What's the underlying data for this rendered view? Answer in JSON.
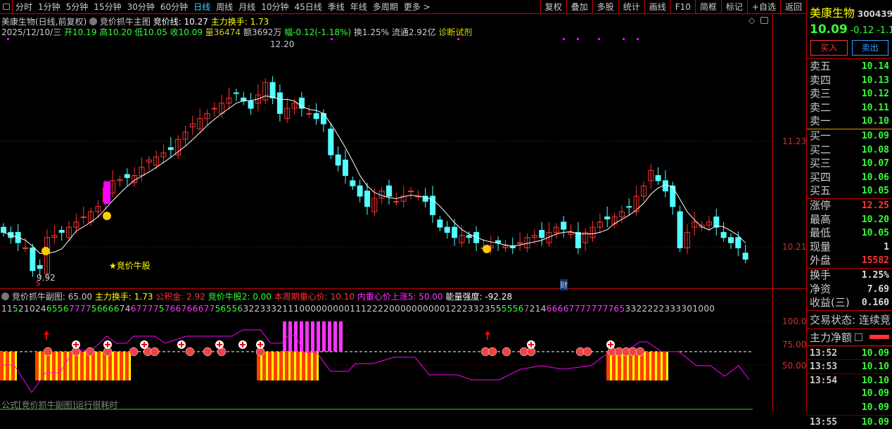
{
  "toolbar": {
    "periods": [
      "分时",
      "1分钟",
      "5分钟",
      "15分钟",
      "30分钟",
      "60分钟",
      "日线",
      "周线",
      "月线",
      "10分钟",
      "45日线",
      "季线",
      "年线",
      "多周期",
      "更多 >"
    ],
    "active": "日线",
    "actions": [
      "复权",
      "叠加",
      "多股",
      "统计",
      "画线",
      "F10",
      "简框",
      "标记",
      "+自选",
      "返回"
    ]
  },
  "header": {
    "stock": "美康生物(日线,前复权)",
    "indicator": "竞价抓牛主图",
    "jjx_label": "竞价线: 10.27",
    "zlhs_label": "主力换手: 1.73"
  },
  "quote_line": {
    "date": "2025/12/10/三",
    "open": "开10.19",
    "high": "高10.20",
    "low": "低10.05",
    "close": "收10.09",
    "volume": "量36474",
    "amount": "额3692万",
    "change": "幅-0.12(-1.18%)",
    "turnover": "换1.25%",
    "float": "流通2.92亿",
    "diag": "诊断试剂"
  },
  "chart_data": {
    "type": "candlestick",
    "yticks": [
      "11.23",
      "10.21"
    ],
    "max_label": "12.20",
    "min_label": "9.92",
    "annotations": [
      "★竞价牛股",
      "财",
      "S"
    ],
    "closes": [
      10.35,
      10.3,
      10.25,
      10.2,
      9.98,
      10.0,
      10.3,
      10.32,
      10.35,
      10.4,
      10.45,
      10.5,
      10.55,
      10.6,
      10.78,
      10.85,
      10.86,
      10.88,
      10.9,
      10.98,
      11.05,
      11.08,
      11.12,
      11.15,
      11.25,
      11.32,
      11.4,
      11.45,
      11.5,
      11.55,
      11.6,
      11.65,
      11.7,
      11.62,
      11.55,
      11.68,
      11.8,
      11.65,
      11.5,
      11.55,
      11.6,
      11.55,
      11.5,
      11.45,
      11.4,
      11.1,
      11.0,
      10.9,
      10.8,
      10.7,
      10.6,
      10.68,
      10.75,
      10.7,
      10.65,
      10.7,
      10.75,
      10.7,
      10.65,
      10.52,
      10.4,
      10.35,
      10.3,
      10.32,
      10.3,
      10.25,
      10.2,
      10.22,
      10.25,
      10.22,
      10.2,
      10.25,
      10.3,
      10.32,
      10.3,
      10.35,
      10.4,
      10.38,
      10.35,
      10.2,
      10.35,
      10.4,
      10.45,
      10.48,
      10.5,
      10.55,
      10.6,
      10.7,
      10.8,
      10.95,
      10.85,
      10.75,
      10.6,
      10.2,
      10.35,
      10.45,
      10.42,
      10.45,
      10.4,
      10.3,
      10.25,
      10.2,
      10.09
    ],
    "up_color": "#ff3232",
    "down_color": "#54ffff",
    "ma_color": "#ffffff"
  },
  "sub": {
    "name": "竞价抓牛副图",
    "v1": ": 65.00",
    "zlhs": "主力换手: 1.73",
    "gjj": "公积金: 2.92",
    "jjng": "竞价牛股2: 0.00",
    "zxj": "本周期重心价: 10.10",
    "sz": "内重心价上涨5: 50.00",
    "nl": "能量强度: -92.28",
    "yticks": [
      "100.0",
      "75.00",
      "50.00"
    ],
    "digits": [
      [
        "11",
        "#ccc"
      ],
      [
        "5",
        "#3f3"
      ],
      [
        "21024",
        "#ccc"
      ],
      [
        "6556",
        "#3f3"
      ],
      [
        "7777",
        "#f3f"
      ],
      [
        "56666",
        "#3f3"
      ],
      [
        "74",
        "#ccc"
      ],
      [
        "67777",
        "#f3f"
      ],
      [
        "5",
        "#3f3"
      ],
      [
        "766766677",
        "#f3f"
      ],
      [
        "56556",
        "#3f3"
      ],
      [
        "3223332111000000000111222200000000001222332355",
        "#ccc"
      ],
      [
        "5556",
        "#3f3"
      ],
      [
        "7",
        "#f3f"
      ],
      [
        "214",
        "#ccc"
      ],
      [
        "66667777777765",
        "#f3f"
      ],
      [
        "3322222333301000",
        "#ccc"
      ]
    ],
    "footer": "公式[竞价抓牛副图]运行很耗时"
  },
  "panel": {
    "name": "美康生物",
    "code": "300439",
    "price": "10.09",
    "chg": "-0.12",
    "pct": "-1.1",
    "buy": "买入",
    "sell": "卖出",
    "asks": [
      [
        "卖五",
        "10.14"
      ],
      [
        "卖四",
        "10.13"
      ],
      [
        "卖三",
        "10.12"
      ],
      [
        "卖二",
        "10.11"
      ],
      [
        "卖一",
        "10.10"
      ]
    ],
    "bids": [
      [
        "买一",
        "10.09"
      ],
      [
        "买二",
        "10.08"
      ],
      [
        "买三",
        "10.07"
      ],
      [
        "买四",
        "10.06"
      ],
      [
        "买五",
        "10.05"
      ]
    ],
    "stats": [
      [
        "涨停",
        "12.25",
        "#ff3232"
      ],
      [
        "最高",
        "10.20",
        "#3f3"
      ],
      [
        "最低",
        "10.05",
        "#3f3"
      ],
      [
        "现量",
        "1",
        "#ddd"
      ],
      [
        "外盘",
        "15582",
        "#ff3232"
      ]
    ],
    "fin": [
      [
        "换手",
        "1.25%"
      ],
      [
        "净资",
        "7.69"
      ],
      [
        "收益(三)",
        "0.160"
      ]
    ],
    "status": "交易状态: 连续竞",
    "zljd": "主力净额",
    "ticks": [
      [
        "13:52",
        "10.09"
      ],
      [
        "13:53",
        "10.10"
      ],
      [
        "13:54",
        "10.10"
      ],
      [
        "",
        "10.09"
      ],
      [
        "",
        "10.09"
      ],
      [
        "13:55",
        "10.09"
      ]
    ]
  }
}
